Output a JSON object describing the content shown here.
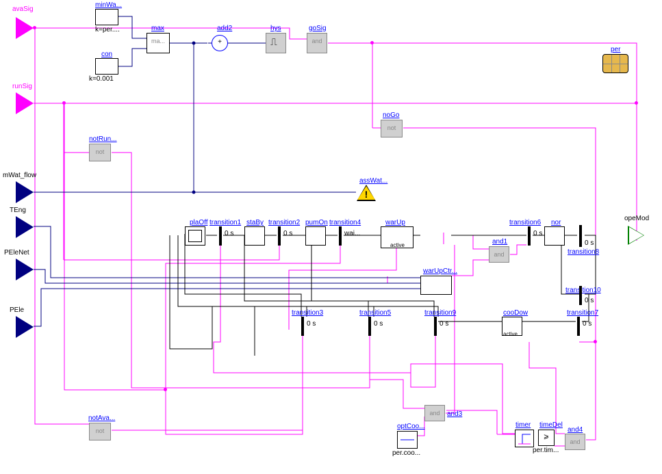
{
  "inputs": {
    "avaSig": "avaSig",
    "runSig": "runSig",
    "mWat_flow": "mWat_flow",
    "TEng": "TEng",
    "PEleNet": "PEleNet",
    "PEle": "PEle"
  },
  "outputs": {
    "opeMod": "opeMod"
  },
  "top": {
    "minWa": "minWa...",
    "minWa_k": "k=per....",
    "con": "con",
    "con_k": "k=0.001",
    "max": "max",
    "max_txt": "ma...",
    "add2": "add2",
    "hys": "hys",
    "goSig": "goSig",
    "and": "and",
    "per": "per"
  },
  "mid": {
    "notRun": "notRun...",
    "not": "not",
    "noGo": "noGo",
    "not2": "not",
    "assWat": "assWat..."
  },
  "chain": {
    "plaOff": "plaOff",
    "transition1": "transition1",
    "t1_time": "0 s",
    "staBy": "staBy",
    "transition2": "transition2",
    "t2_time": "0 s",
    "pumOn": "pumOn",
    "transition4": "transition4",
    "t4_wai": "wai...",
    "warUp": "warUp",
    "active": "active",
    "transition6": "transition6",
    "t6_time": "0 s",
    "nor": "nor",
    "transition8": "transition8",
    "t8_time": "0 s",
    "and1": "and1",
    "and1_txt": "and",
    "warUpCtr": "warUpCtr...",
    "transition3": "transition3",
    "t3_time": "0 s",
    "transition5": "transition5",
    "t5_time": "0 s",
    "transition9": "transition9",
    "t9_time": "0 s",
    "cooDow": "cooDow",
    "active2": "active",
    "transition7": "transition7",
    "t7_time": "0 s",
    "transition10": "transition10",
    "t10_time": "0 s"
  },
  "bottom": {
    "notAva": "notAva...",
    "not3": "not",
    "and3_block": "and",
    "and3": "and3",
    "optCoo": "optCoo...",
    "optCoo_sub": "per.coo...",
    "timer": "timer",
    "timeDel": "timeDel",
    "timeDel_sub": "per.tim...",
    "and4": "and4",
    "and4_txt": "and"
  }
}
